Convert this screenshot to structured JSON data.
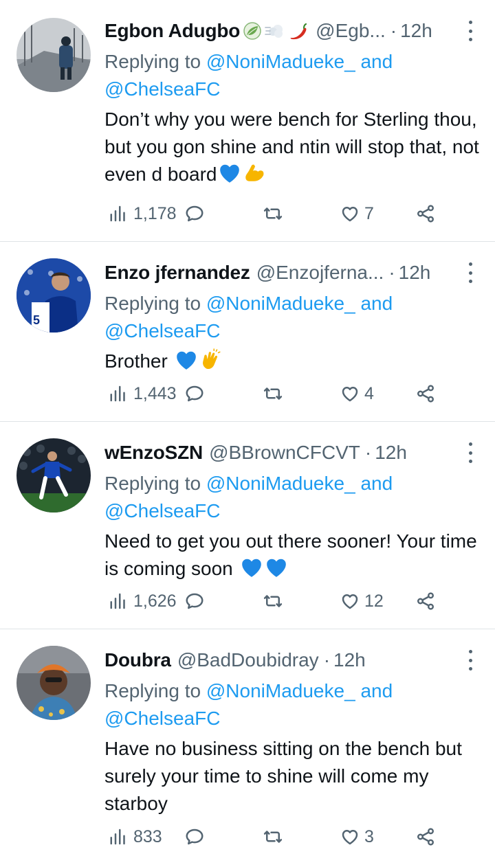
{
  "tweets": [
    {
      "name": "Egbon Adugbo",
      "emojis": [
        "leaf-icon",
        "dash-icon",
        "chili-icon"
      ],
      "handle": "@Egb...",
      "dot": "·",
      "time": "12h",
      "replying_prefix": "Replying to",
      "reply_user1": "@NoniMadueke_",
      "reply_and": "and",
      "reply_user2": "@ChelseaFC",
      "body": "Don’t why you were bench for Sterling thou, but you gon shine and ntin will stop that, not even d board",
      "body_emojis": [
        "blue-heart-icon",
        "flexed-biceps-icon"
      ],
      "views": "1,178",
      "retweets": "",
      "likes": "7"
    },
    {
      "name": "Enzo jfernandez",
      "emojis": [],
      "handle": "@Enzojferna...",
      "dot": "·",
      "time": "12h",
      "replying_prefix": "Replying to",
      "reply_user1": "@NoniMadueke_",
      "reply_and": "and",
      "reply_user2": "@ChelseaFC",
      "body": "Brother",
      "body_emojis": [
        "blue-heart-icon",
        "clapping-hands-icon"
      ],
      "views": "1,443",
      "retweets": "",
      "likes": "4"
    },
    {
      "name": "wEnzoSZN",
      "emojis": [],
      "handle": "@BBrownCFCVT",
      "dot": "·",
      "time": "12h",
      "replying_prefix": "Replying to",
      "reply_user1": "@NoniMadueke_",
      "reply_and": "and",
      "reply_user2": "@ChelseaFC",
      "body": "Need to get you out there sooner! Your time is coming soon",
      "body_emojis": [
        "blue-heart-icon",
        "blue-heart-icon"
      ],
      "views": "1,626",
      "retweets": "",
      "likes": "12"
    },
    {
      "name": "Doubra",
      "emojis": [],
      "handle": "@BadDoubidray",
      "dot": "·",
      "time": "12h",
      "replying_prefix": "Replying to",
      "reply_user1": "@NoniMadueke_",
      "reply_and": "and",
      "reply_user2": "@ChelseaFC",
      "body": "Have no business sitting on the bench but surely your time to shine will come my starboy",
      "body_emojis": [],
      "views": "833",
      "retweets": "",
      "likes": "3"
    }
  ],
  "colors": {
    "text": "#0f1419",
    "secondary": "#536471",
    "link": "#1d9bf0",
    "divider": "#dfe3e6"
  }
}
